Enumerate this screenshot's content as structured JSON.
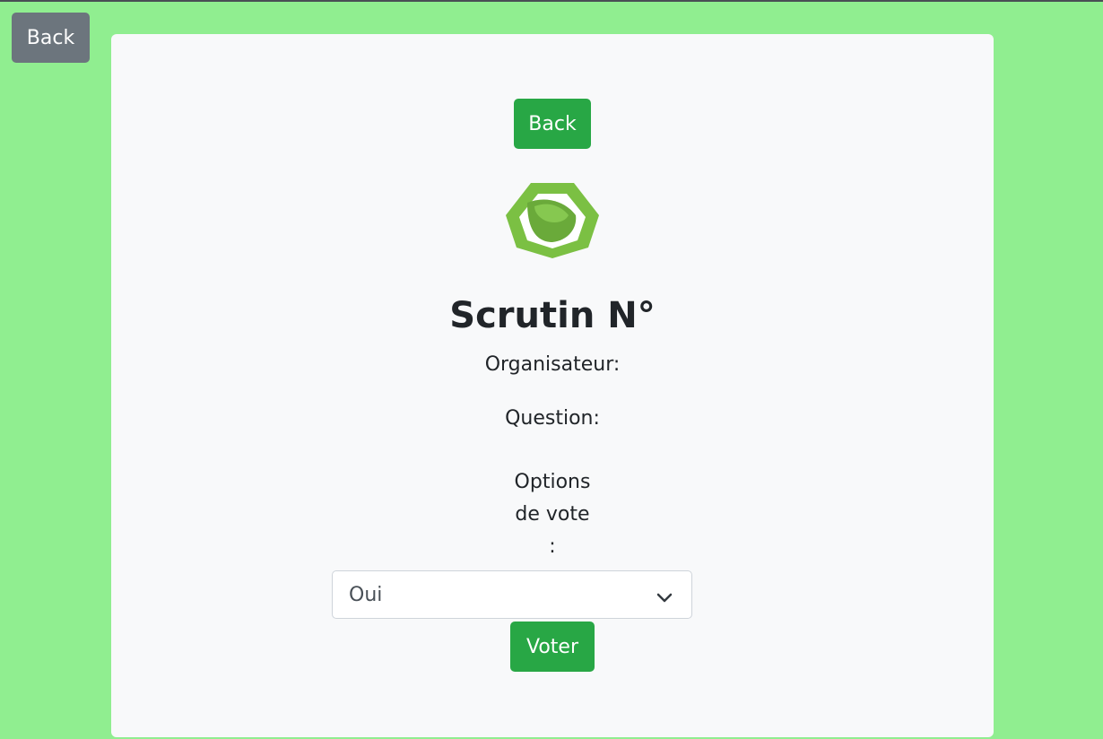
{
  "outer_back_label": "Back",
  "card": {
    "back_label": "Back",
    "logo_icon": "leaf-hexagon-logo",
    "title": "Scrutin N°",
    "organisateur_label": "Organisateur:",
    "question_label": "Question:",
    "options_label": [
      "Options",
      "de vote",
      ":"
    ],
    "select": {
      "selected": "Oui",
      "icon": "chevron-down-icon"
    },
    "vote_label": "Voter"
  },
  "colors": {
    "background": "#90ee90",
    "card": "#f8f9fa",
    "success": "#28a745",
    "secondary": "#6c757d",
    "logo_light": "#7bc043",
    "logo_dark": "#6aaa3a"
  }
}
